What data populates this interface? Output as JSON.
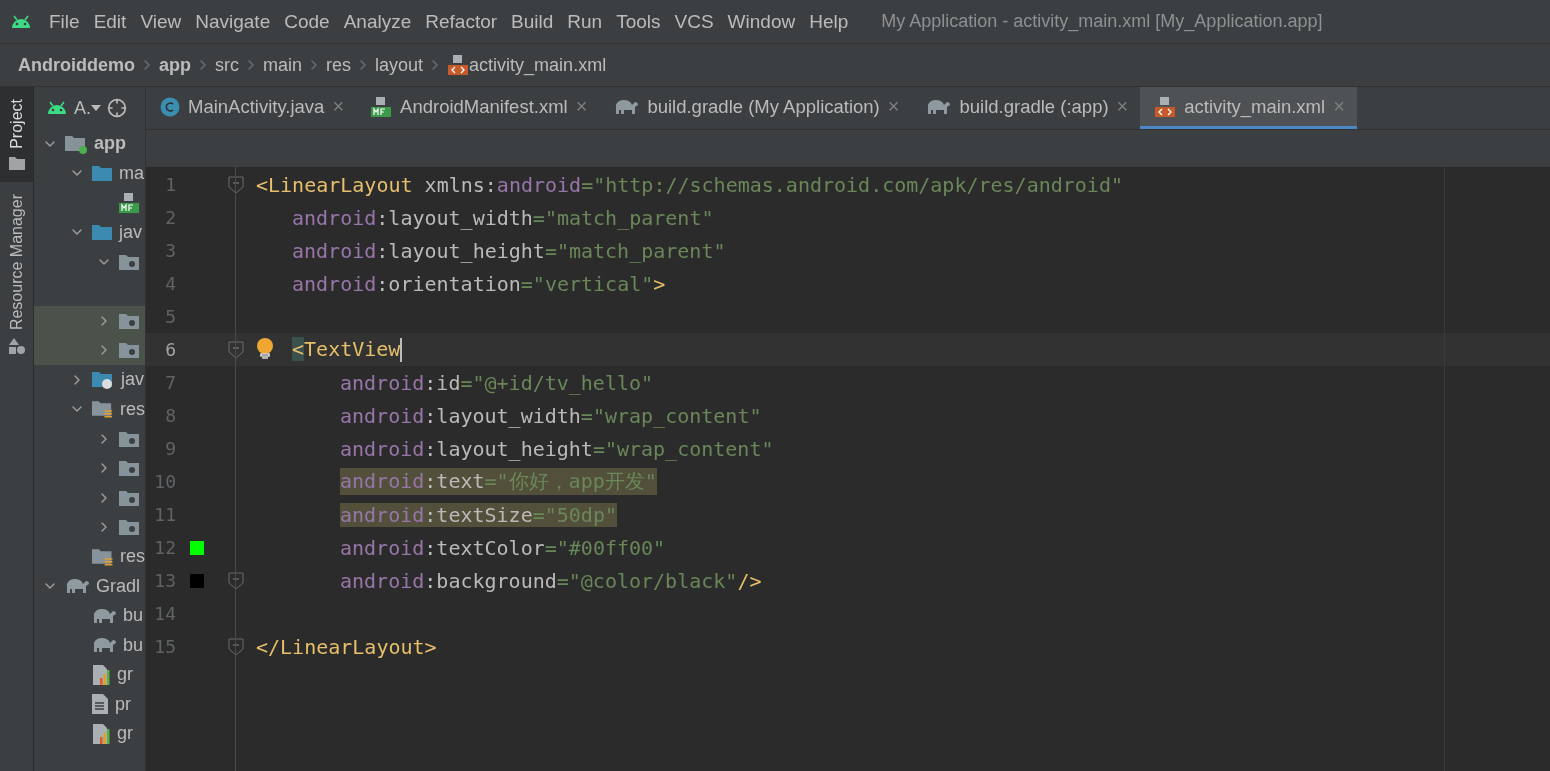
{
  "menu": {
    "items": [
      "File",
      "Edit",
      "View",
      "Navigate",
      "Code",
      "Analyze",
      "Refactor",
      "Build",
      "Run",
      "Tools",
      "VCS",
      "Window",
      "Help"
    ],
    "title": "My Application - activity_main.xml [My_Application.app]"
  },
  "breadcrumbs": [
    {
      "label": "Androiddemo",
      "kind": "bold"
    },
    {
      "label": "app",
      "kind": "bold"
    },
    {
      "label": "src",
      "kind": "plain"
    },
    {
      "label": "main",
      "kind": "plain"
    },
    {
      "label": "res",
      "kind": "plain"
    },
    {
      "label": "layout",
      "kind": "plain"
    },
    {
      "label": "activity_main.xml",
      "kind": "xml"
    }
  ],
  "tool_strip": [
    {
      "label": "Project",
      "selected": true,
      "kind": "project"
    },
    {
      "label": "Resource Manager",
      "selected": false,
      "kind": "resources"
    }
  ],
  "project_panel": {
    "view_label": "A.",
    "tree": [
      {
        "label": "app",
        "kind": "module",
        "expanded": true,
        "selected": false,
        "children": [
          {
            "label": "ma",
            "kind": "folder",
            "expanded": true,
            "selected": false,
            "children": [
              {
                "kind": "manifest",
                "selected": false
              }
            ]
          },
          {
            "label": "jav",
            "kind": "folder",
            "expanded": true,
            "selected": false,
            "children": [
              {
                "kind": "package",
                "expanded": true,
                "selected": false
              },
              {
                "kind": "package",
                "expanded": false,
                "selected": true
              },
              {
                "kind": "package",
                "expanded": false,
                "selected": true
              }
            ]
          },
          {
            "label": "jav",
            "kind": "generated",
            "expanded": false,
            "selected": false
          },
          {
            "label": "res",
            "kind": "res",
            "expanded": true,
            "selected": false,
            "children": [
              {
                "kind": "package",
                "expanded": false,
                "selected": false
              },
              {
                "kind": "package",
                "expanded": false,
                "selected": false
              },
              {
                "kind": "package",
                "expanded": false,
                "selected": false
              },
              {
                "kind": "package",
                "expanded": false,
                "selected": false
              }
            ]
          },
          {
            "label": "res",
            "kind": "res",
            "selected": false
          }
        ]
      },
      {
        "label": "Gradl",
        "kind": "gradle",
        "expanded": true,
        "selected": false,
        "children": [
          {
            "label": "bu",
            "kind": "gradle",
            "selected": false
          },
          {
            "label": "bu",
            "kind": "gradle",
            "selected": false
          },
          {
            "label": "gr",
            "kind": "props",
            "selected": false
          },
          {
            "label": "pr",
            "kind": "text",
            "selected": false
          },
          {
            "label": "gr",
            "kind": "props",
            "selected": false
          }
        ]
      }
    ]
  },
  "tabs": [
    {
      "label": "MainActivity.java",
      "kind": "java",
      "selected": false,
      "close": "×"
    },
    {
      "label": "AndroidManifest.xml",
      "kind": "manifest",
      "selected": false,
      "close": "×"
    },
    {
      "label": "build.gradle (My Application)",
      "kind": "gradle",
      "selected": false,
      "close": "×"
    },
    {
      "label": "build.gradle (:app)",
      "kind": "gradle",
      "selected": false,
      "close": "×"
    },
    {
      "label": "activity_main.xml",
      "kind": "xml",
      "selected": true,
      "close": "×"
    }
  ],
  "editor": {
    "lines": [
      {
        "number": "1",
        "fold": true,
        "current": false,
        "tokens": [
          {
            "text": "<LinearLayout",
            "kind": "tag"
          },
          {
            "text": " xmlns:",
            "kind": "attr"
          },
          {
            "text": "android",
            "kind": "ns"
          },
          {
            "text": "=\"http://schemas.android.com/apk/res/android\"",
            "kind": "str"
          }
        ],
        "children": [
          {
            "number": "2",
            "current": false,
            "tokens": [
              {
                "text": "android",
                "kind": "ns"
              },
              {
                "text": ":layout_width",
                "kind": "attr"
              },
              {
                "text": "=\"match_parent\"",
                "kind": "str"
              }
            ]
          },
          {
            "number": "3",
            "current": false,
            "tokens": [
              {
                "text": "android",
                "kind": "ns"
              },
              {
                "text": ":layout_height",
                "kind": "attr"
              },
              {
                "text": "=\"match_parent\"",
                "kind": "str"
              }
            ]
          },
          {
            "number": "4",
            "current": false,
            "tokens": [
              {
                "text": "android",
                "kind": "ns"
              },
              {
                "text": ":orientation",
                "kind": "attr"
              },
              {
                "text": "=\"vertical\"",
                "kind": "str"
              },
              {
                "text": ">",
                "kind": "tag"
              }
            ]
          },
          {
            "number": "5",
            "current": false
          },
          {
            "number": "6",
            "fold": true,
            "current": true,
            "bulb": true,
            "tokens": [
              {
                "text": "<",
                "kind": "tag",
                "match": true
              },
              {
                "text": "TextView",
                "kind": "tag"
              }
            ],
            "children": [
              {
                "number": "7",
                "current": false,
                "tokens": [
                  {
                    "text": "android",
                    "kind": "ns"
                  },
                  {
                    "text": ":id",
                    "kind": "attr"
                  },
                  {
                    "text": "=\"@+id/tv_hello\"",
                    "kind": "str"
                  }
                ]
              },
              {
                "number": "8",
                "current": false,
                "tokens": [
                  {
                    "text": "android",
                    "kind": "ns"
                  },
                  {
                    "text": ":layout_width",
                    "kind": "attr"
                  },
                  {
                    "text": "=\"wrap_content\"",
                    "kind": "str"
                  }
                ]
              },
              {
                "number": "9",
                "current": false,
                "tokens": [
                  {
                    "text": "android",
                    "kind": "ns"
                  },
                  {
                    "text": ":layout_height",
                    "kind": "attr"
                  },
                  {
                    "text": "=\"wrap_content\"",
                    "kind": "str"
                  }
                ]
              },
              {
                "number": "10",
                "current": false,
                "highlighted": true,
                "tokens": [
                  {
                    "text": "android",
                    "kind": "ns"
                  },
                  {
                    "text": ":text",
                    "kind": "attr"
                  },
                  {
                    "text": "=\"你好，app开发\"",
                    "kind": "str"
                  }
                ]
              },
              {
                "number": "11",
                "current": false,
                "highlighted": true,
                "tokens": [
                  {
                    "text": "android",
                    "kind": "ns"
                  },
                  {
                    "text": ":textSize",
                    "kind": "attr"
                  },
                  {
                    "text": "=\"50dp\"",
                    "kind": "str"
                  }
                ]
              },
              {
                "number": "12",
                "current": false,
                "color": "#00ff00",
                "tokens": [
                  {
                    "text": "android",
                    "kind": "ns"
                  },
                  {
                    "text": ":textColor",
                    "kind": "attr"
                  },
                  {
                    "text": "=\"#00ff00\"",
                    "kind": "str"
                  }
                ]
              },
              {
                "number": "13",
                "fold": true,
                "current": false,
                "color": "#000000",
                "tokens": [
                  {
                    "text": "android",
                    "kind": "ns"
                  },
                  {
                    "text": ":background",
                    "kind": "attr"
                  },
                  {
                    "text": "=\"@color/black\"",
                    "kind": "str"
                  },
                  {
                    "text": "/>",
                    "kind": "tag"
                  }
                ]
              }
            ]
          }
        ]
      },
      {
        "number": "14",
        "current": false
      },
      {
        "number": "15",
        "fold": true,
        "current": false,
        "tokens": [
          {
            "text": "</LinearLayout>",
            "kind": "tag"
          }
        ]
      }
    ]
  }
}
